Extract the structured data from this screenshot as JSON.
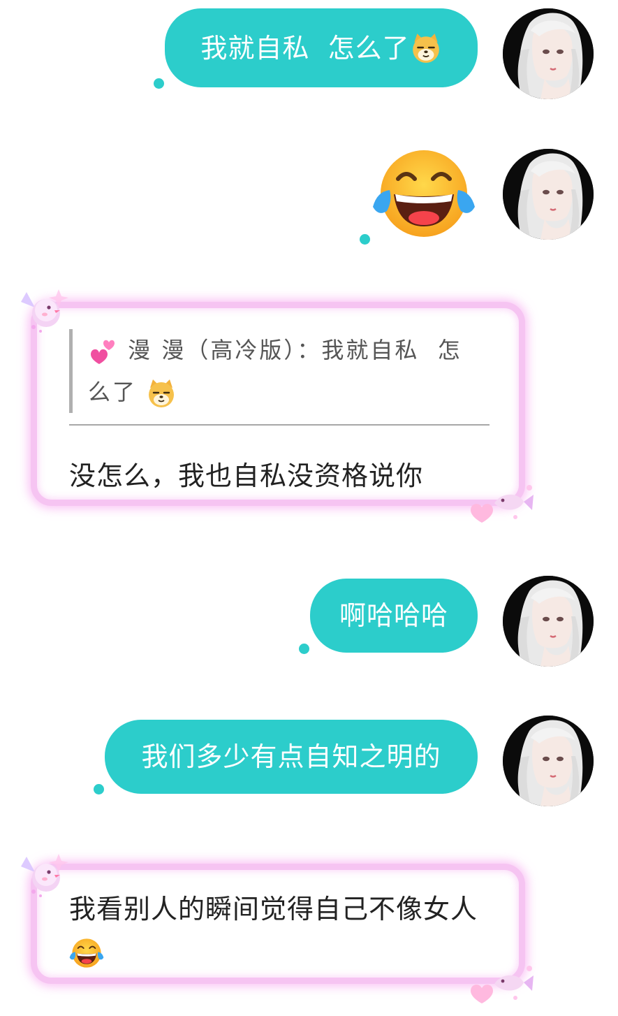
{
  "messages": [
    {
      "side": "outgoing",
      "text": "我就自私  怎么了",
      "sticker": "dog-face-emoji"
    },
    {
      "side": "outgoing",
      "sticker": "tears-of-joy-emoji"
    },
    {
      "side": "incoming",
      "quote": {
        "icon": "two-hearts-emoji",
        "text": "漫 漫（高冷版）：我就自私  怎么了",
        "sticker": "dog-face-emoji"
      },
      "text": "没怎么，我也自私没资格说你"
    },
    {
      "side": "outgoing",
      "text": "啊哈哈哈"
    },
    {
      "side": "outgoing",
      "text": "我们多少有点自知之明的"
    },
    {
      "side": "incoming",
      "text": "我看别人的瞬间觉得自己不像女人",
      "sticker": "tears-of-joy-emoji"
    }
  ],
  "colors": {
    "outgoing_bubble": "#2ccdcb",
    "incoming_frame": "#f6c4f2",
    "avatar_background": "#0b0b0b"
  },
  "icons": [
    "avatar",
    "bird-decoration-icon",
    "heart-fish-decoration-icon"
  ]
}
